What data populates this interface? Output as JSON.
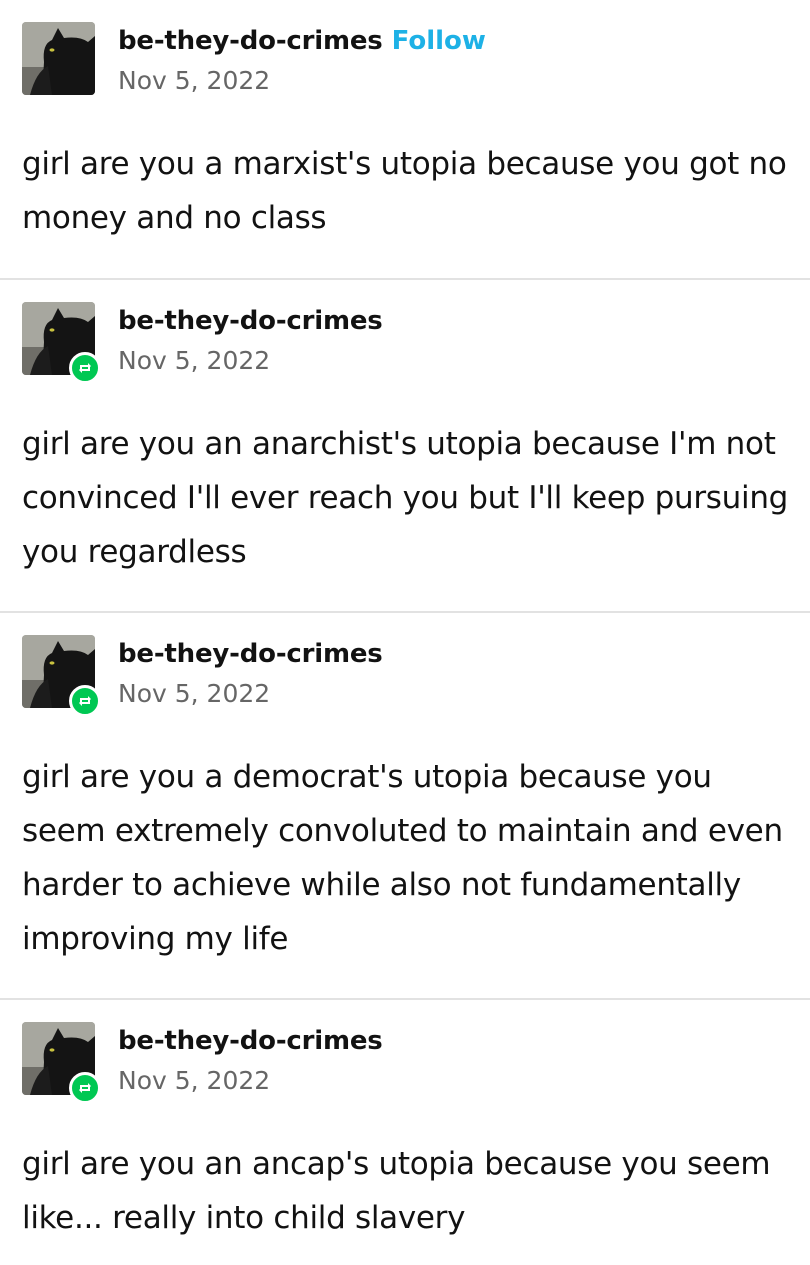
{
  "posts": [
    {
      "username": "be-they-do-crimes",
      "follow_label": "Follow",
      "date": "Nov 5, 2022",
      "is_reblog": false,
      "text": "girl are you a marxist's utopia because you got no money and no class"
    },
    {
      "username": "be-they-do-crimes",
      "date": "Nov 5, 2022",
      "is_reblog": true,
      "text": "girl are you an anarchist's utopia because I'm not convinced I'll ever reach you but I'll keep pursuing you regardless"
    },
    {
      "username": "be-they-do-crimes",
      "date": "Nov 5, 2022",
      "is_reblog": true,
      "text": "girl are you a democrat's utopia because you seem extremely convoluted to maintain and even harder to achieve while also not fundamentally improving my life"
    },
    {
      "username": "be-they-do-crimes",
      "date": "Nov 5, 2022",
      "is_reblog": true,
      "text": "girl are you an ancap's utopia because you seem like... really into child slavery"
    }
  ],
  "colors": {
    "follow": "#1db1e6",
    "reblog_badge": "#00c853",
    "divider": "#e2e2e2"
  },
  "icons": {
    "avatar": "black-cat-avatar",
    "reblog": "reblog-icon"
  }
}
